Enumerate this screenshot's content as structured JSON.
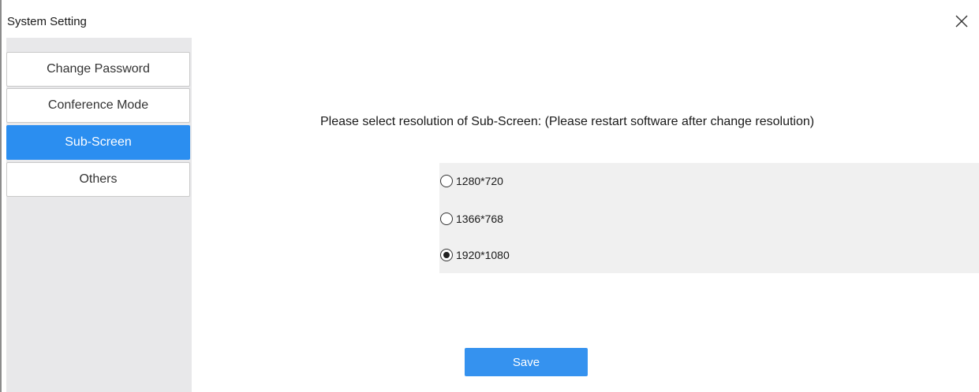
{
  "window": {
    "title": "System Setting",
    "close_icon": "close-icon"
  },
  "sidebar": {
    "items": [
      {
        "label": "Change Password",
        "active": false
      },
      {
        "label": "Conference Mode",
        "active": false
      },
      {
        "label": "Sub-Screen",
        "active": true
      },
      {
        "label": "Others",
        "active": false
      }
    ]
  },
  "main": {
    "prompt": "Please select resolution of Sub-Screen: (Please restart software after change resolution)",
    "options": [
      {
        "label": "1280*720",
        "checked": false
      },
      {
        "label": "1366*768",
        "checked": false
      },
      {
        "label": "1920*1080",
        "checked": true
      }
    ],
    "save_label": "Save"
  },
  "colors": {
    "accent": "#2b8ef0",
    "sidebar_bg": "#e8e8ea",
    "options_bg": "#f0f0f0"
  }
}
